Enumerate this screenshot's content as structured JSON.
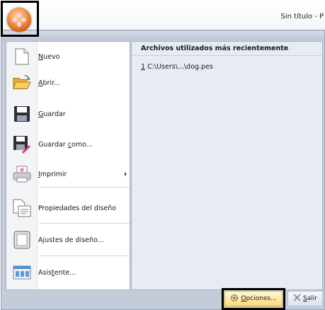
{
  "window": {
    "title": "Sin título - P"
  },
  "menu": {
    "items": [
      {
        "pre": "",
        "key": "N",
        "post": "uevo",
        "icon": "new-document-icon"
      },
      {
        "pre": "",
        "key": "A",
        "post": "brir...",
        "icon": "open-folder-icon"
      },
      {
        "pre": "",
        "key": "G",
        "post": "uardar",
        "icon": "save-disk-icon"
      },
      {
        "pre": "Guardar ",
        "key": "c",
        "post": "omo...",
        "icon": "save-as-icon"
      },
      {
        "pre": "",
        "key": "I",
        "post": "mprimir",
        "icon": "print-icon"
      },
      {
        "pre": "Propiedades del diseño",
        "key": "",
        "post": "",
        "icon": "design-properties-icon"
      },
      {
        "pre": "Ajustes de diseño...",
        "key": "",
        "post": "",
        "icon": "design-settings-icon"
      },
      {
        "pre": "Asis",
        "key": "t",
        "post": "ente...",
        "icon": "wizard-icon"
      }
    ]
  },
  "recent": {
    "header": "Archivos utilizados más recientemente",
    "items": [
      {
        "num": "1",
        "path": " C:\\Users\\...\\dog.pes"
      }
    ]
  },
  "buttons": {
    "options": {
      "pre": "",
      "key": "O",
      "post": "pciones...",
      "icon": "gear-icon"
    },
    "exit": {
      "pre": "",
      "key": "S",
      "post": "alir",
      "icon": "close-x-icon"
    }
  },
  "colors": {
    "accent": "#ffd978",
    "app_orb": "#e07a2a"
  }
}
